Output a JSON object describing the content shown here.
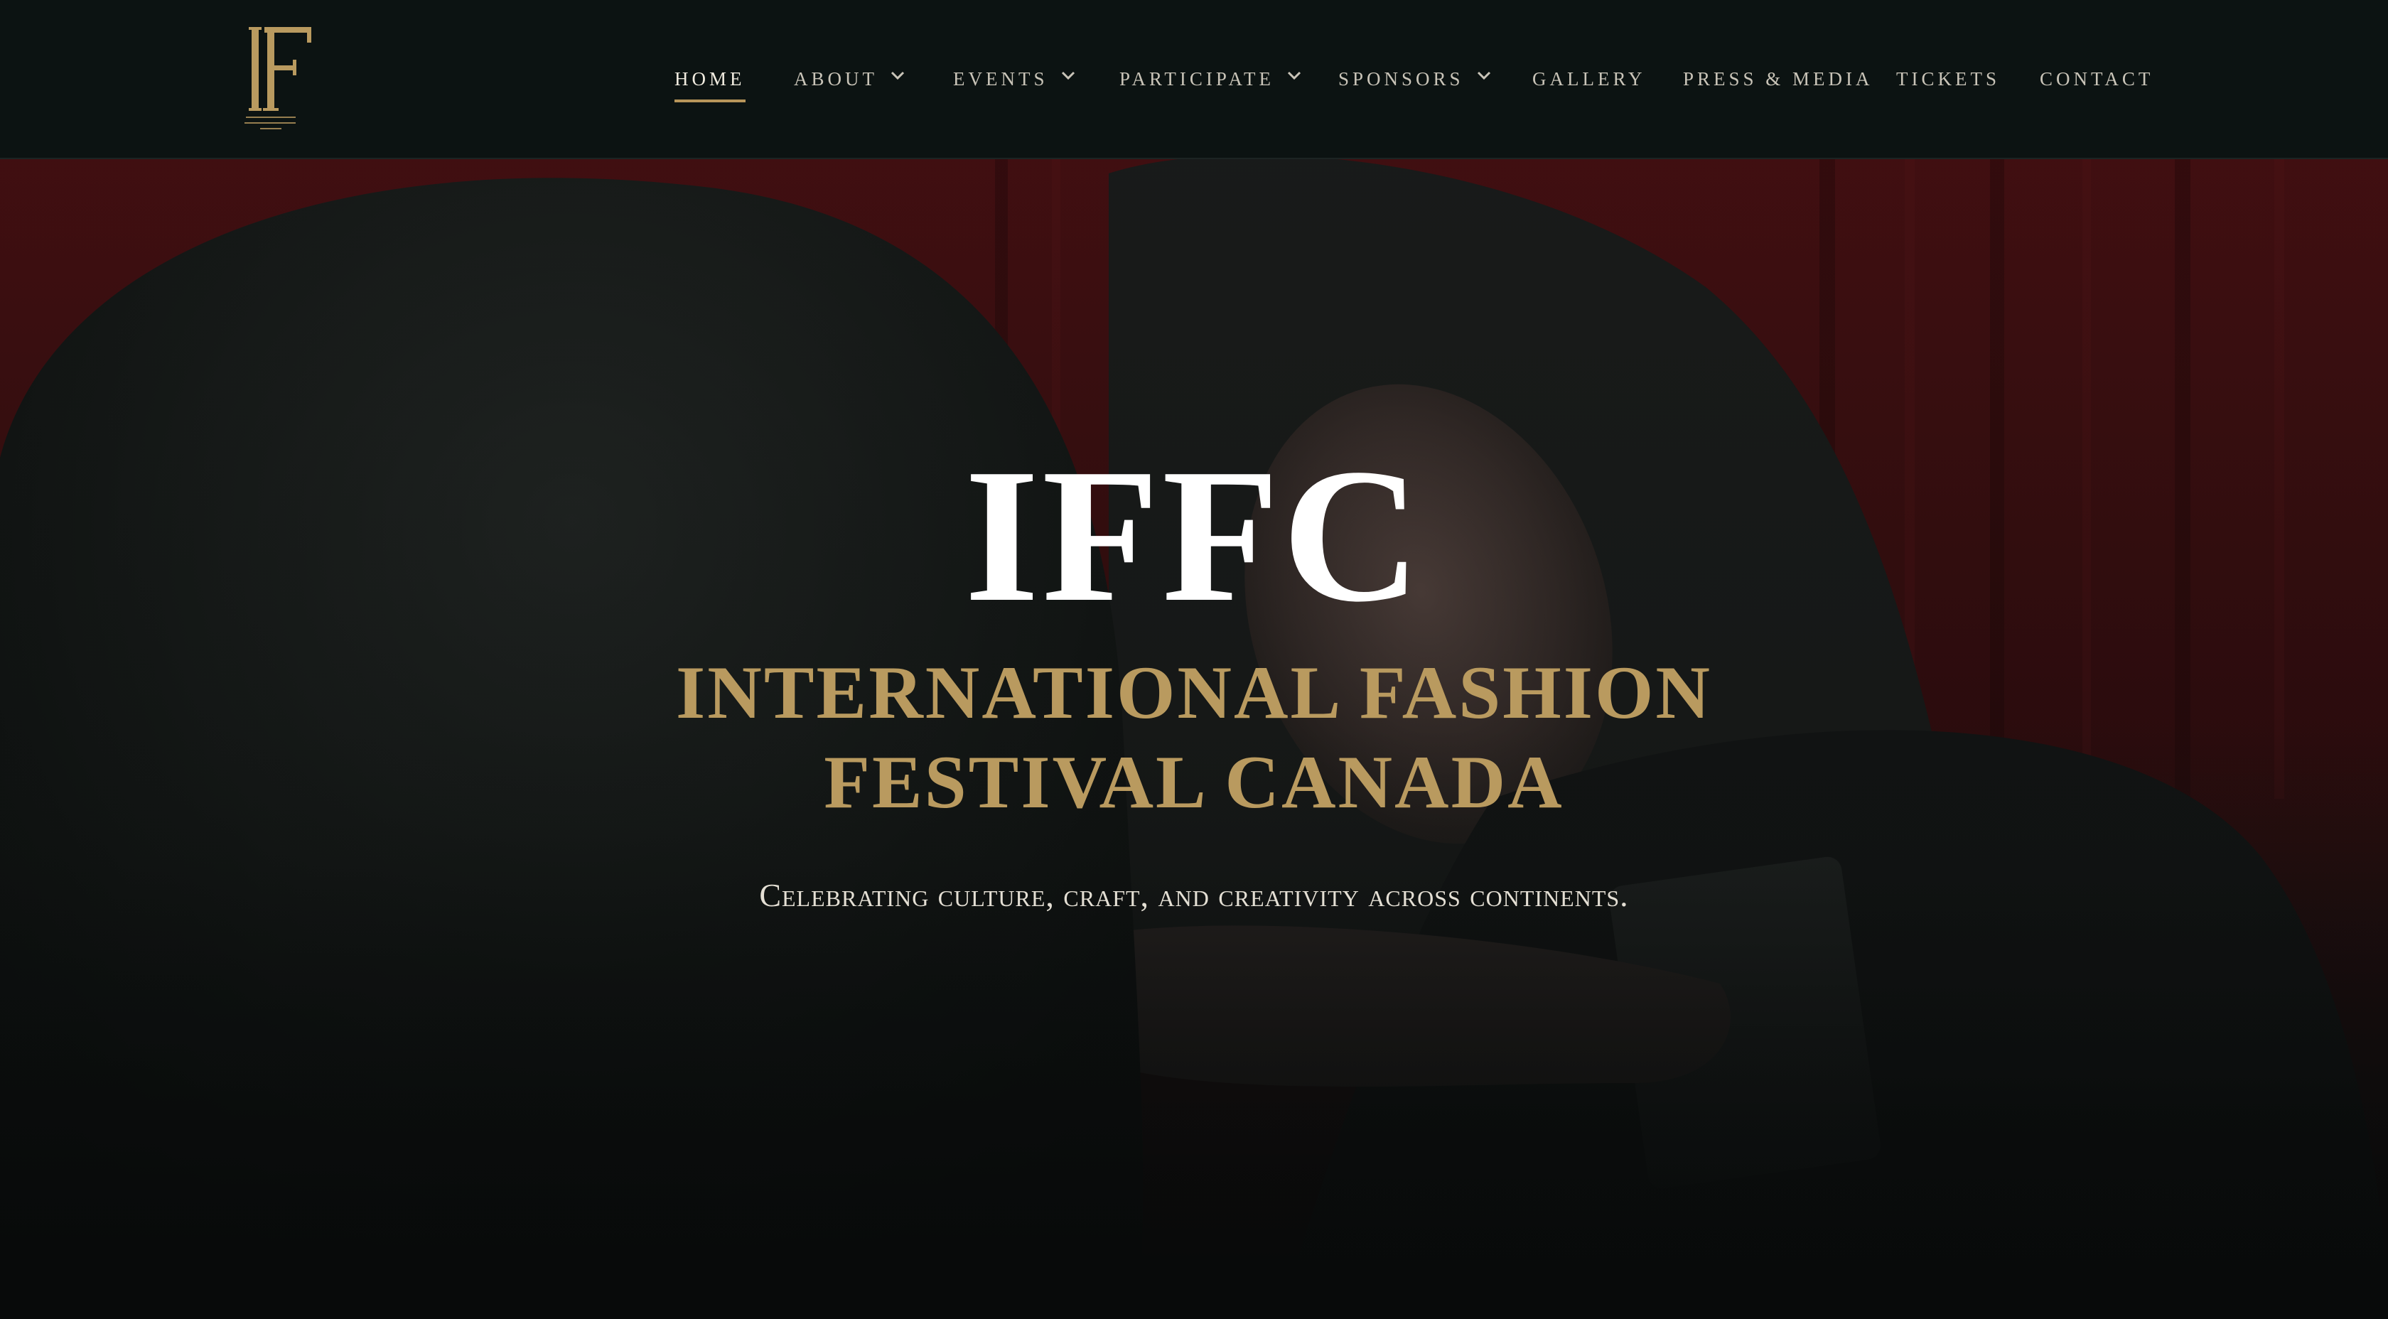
{
  "brand": {
    "logo_mark": "IF",
    "logo_small_text": "INTERNATIONAL FASHION FESTIVAL CANADA",
    "gold_color": "#b99a5f"
  },
  "nav": {
    "items": [
      {
        "label": "HOME",
        "active": true,
        "has_dropdown": false
      },
      {
        "label": "ABOUT",
        "active": false,
        "has_dropdown": true
      },
      {
        "label": "EVENTS",
        "active": false,
        "has_dropdown": true
      },
      {
        "label": "PARTICIPATE",
        "active": false,
        "has_dropdown": true
      },
      {
        "label": "SPONSORS",
        "active": false,
        "has_dropdown": true
      },
      {
        "label": "GALLERY",
        "active": false,
        "has_dropdown": false
      },
      {
        "label": "PRESS & MEDIA",
        "active": false,
        "has_dropdown": false
      },
      {
        "label": "TICKETS",
        "active": false,
        "has_dropdown": false
      },
      {
        "label": "CONTACT",
        "active": false,
        "has_dropdown": false
      }
    ]
  },
  "hero": {
    "title": "IFFC",
    "subtitle_line1": "INTERNATIONAL FASHION",
    "subtitle_line2": "FESTIVAL CANADA",
    "tagline": "Celebrating culture, craft, and creativity across continents."
  }
}
